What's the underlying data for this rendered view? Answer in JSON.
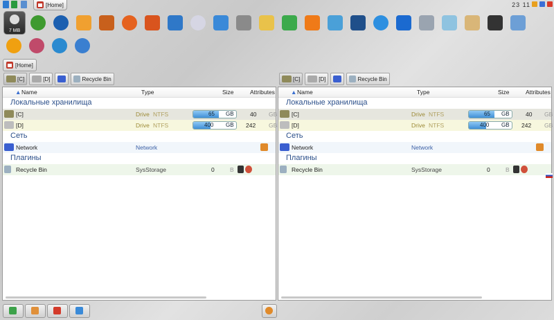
{
  "topbar": {
    "home_tab": "[Home]",
    "clock": "23 11"
  },
  "ram_widget": {
    "label": "7 MB"
  },
  "icons_row1": [
    "ram-icon",
    "utorrent-icon",
    "ccleaner-icon",
    "pdf-icon",
    "archive-icon",
    "firefox-icon",
    "package-icon",
    "screen-icon",
    "disc-icon",
    "windows-icon",
    "printer-icon",
    "folder-icon",
    "puzzle-icon",
    "media-player-icon",
    "telegram-icon",
    "monitor-icon",
    "ie-icon",
    "cloud-icon",
    "calculator-icon",
    "notepad-icon",
    "paint-icon",
    "microphone-icon",
    "app-window-icon"
  ],
  "icons_row2": [
    "headphones-icon",
    "spiral-icon",
    "sync-icon",
    "globe-icon"
  ],
  "home_button": "[Home]",
  "colors": {
    "accent_bar": "#3f8fd6",
    "group_text": "#2b4f8a",
    "network_text": "#3a5fa5"
  },
  "left_panel": {
    "drive_buttons": [
      "[C]",
      "[D]",
      "",
      "Recycle Bin"
    ],
    "columns": {
      "name": "Name",
      "type": "Type",
      "size": "Size",
      "attributes": "Attributes"
    },
    "groups": {
      "local": "Локальные хранилища",
      "network": "Сеть",
      "plugins": "Плагины"
    },
    "drives": [
      {
        "name": "[C]",
        "type": "Drive",
        "fs": "NTFS",
        "size": "65",
        "unit": "GB",
        "free": "40",
        "free_unit": "GB",
        "fill": 0.6
      },
      {
        "name": "[D]",
        "type": "Drive",
        "fs": "NTFS",
        "size": "400",
        "unit": "GB",
        "free": "242",
        "free_unit": "GB",
        "fill": 0.4
      }
    ],
    "network": {
      "name": "Network",
      "type": "Network"
    },
    "plugin": {
      "name": "Recycle Bin",
      "type": "SysStorage",
      "size": "0",
      "unit": "B"
    }
  },
  "right_panel": {
    "drive_buttons": [
      "[C]",
      "[D]",
      "",
      "Recycle Bin"
    ],
    "columns": {
      "name": "Name",
      "type": "Type",
      "size": "Size",
      "attributes": "Attributes"
    },
    "groups": {
      "local": "Локальные хранилища",
      "network": "Сеть",
      "plugins": "Плагины"
    },
    "drives": [
      {
        "name": "[C]",
        "type": "Drive",
        "fs": "NTFS",
        "size": "65",
        "unit": "GB",
        "free": "40",
        "free_unit": "GB",
        "fill": 0.6
      },
      {
        "name": "[D]",
        "type": "Drive",
        "fs": "NTFS",
        "size": "400",
        "unit": "GB",
        "free": "242",
        "free_unit": "GB",
        "fill": 0.4
      }
    ],
    "network": {
      "name": "Network",
      "type": "Network"
    },
    "plugin": {
      "name": "Recycle Bin",
      "type": "SysStorage",
      "size": "0",
      "unit": "B"
    }
  },
  "bottom_buttons": [
    "copy-icon",
    "move-icon",
    "delete-icon",
    "new-folder-icon"
  ]
}
